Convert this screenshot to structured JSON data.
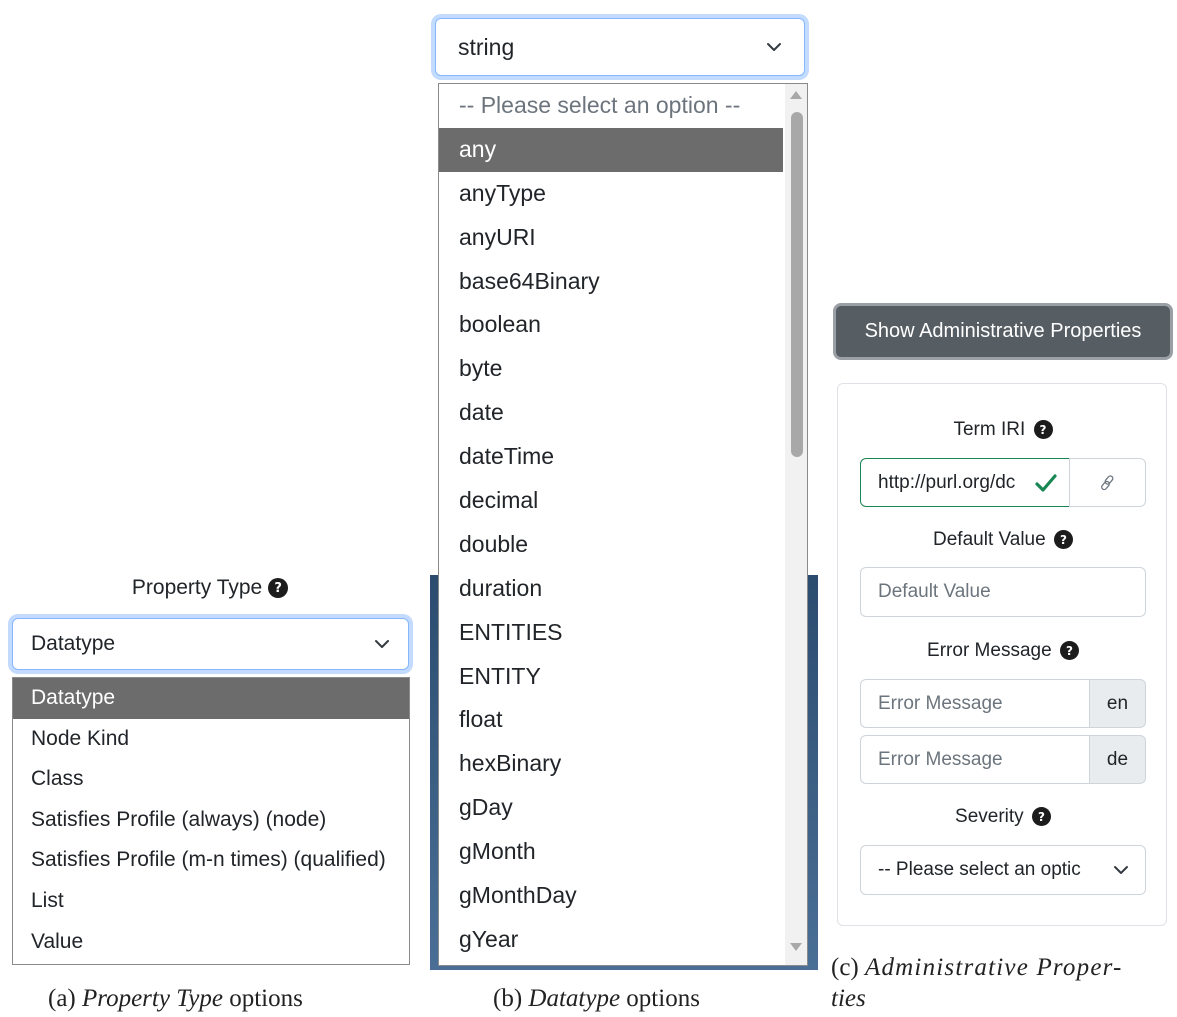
{
  "panel_a": {
    "label": "Property Type",
    "selected": "Datatype",
    "options": [
      "Datatype",
      "Node Kind",
      "Class",
      "Satisfies Profile (always) (node)",
      "Satisfies Profile (m-n times) (qualified)",
      "List",
      "Value"
    ],
    "highlighted": "Datatype",
    "caption_prefix": "(a)",
    "caption_italic": "Property Type",
    "caption_suffix": "options"
  },
  "panel_b": {
    "selected": "string",
    "options": [
      "-- Please select an option --",
      "any",
      "anyType",
      "anyURI",
      "base64Binary",
      "boolean",
      "byte",
      "date",
      "dateTime",
      "decimal",
      "double",
      "duration",
      "ENTITIES",
      "ENTITY",
      "float",
      "hexBinary",
      "gDay",
      "gMonth",
      "gMonthDay",
      "gYear"
    ],
    "highlighted": "any",
    "caption_prefix": "(b)",
    "caption_italic": "Datatype",
    "caption_suffix": "options"
  },
  "panel_c": {
    "button_label": "Show Administrative Properties",
    "term_iri_label": "Term IRI",
    "term_iri_value": "http://purl.org/dc",
    "default_value_label": "Default Value",
    "default_value_placeholder": "Default Value",
    "error_message_label": "Error Message",
    "error_message_placeholder": "Error Message",
    "lang_en": "en",
    "lang_de": "de",
    "severity_label": "Severity",
    "severity_value": "-- Please select an optic",
    "caption_line1_prefix": "(c)",
    "caption_line1_italic": "Administrative Proper-",
    "caption_line2_italic": "ties"
  },
  "colors": {
    "selected_option_bg": "#6c6c6c",
    "admin_button_bg": "#565e64",
    "valid_green": "#198754",
    "focus_blue": "#86b7fe"
  },
  "icons": [
    "question-circle-icon",
    "chevron-down-icon",
    "check-icon",
    "link-icon",
    "scroll-up-arrow-icon",
    "scroll-down-arrow-icon"
  ]
}
